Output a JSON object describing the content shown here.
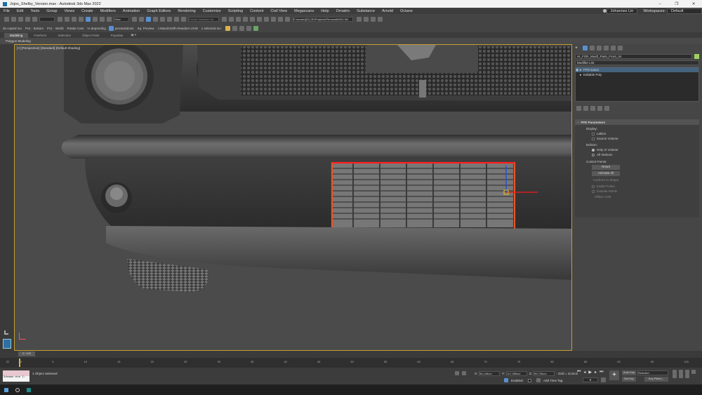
{
  "title": "Jojos_Shelby_Version.max - Autodesk 3ds Max 2022",
  "window_controls": [
    "–",
    "❐",
    "✕"
  ],
  "menu": [
    "File",
    "Edit",
    "Tools",
    "Group",
    "Views",
    "Create",
    "Modifiers",
    "Animation",
    "Graph Editors",
    "Rendering",
    "Customize",
    "Scripting",
    "Content",
    "Civil View",
    "Megascans",
    "Help",
    "Ornatrix",
    "Substance",
    "Arnold",
    "Octane"
  ],
  "user": "Johannes Lin",
  "workspaces_label": "Workspaces:",
  "workspace_value": "Default",
  "view_dropdown": "View",
  "create_selection_set": "Create Selection Se",
  "project_path": "E:\\nudes\\[02] 3D\\Projects\\Personal\\MX4 M4",
  "toolbar2_items": [
    "do copied mo",
    "Pv1 · Bottom",
    "Pv1 · World",
    "Rotate Cam",
    "% depending",
    "perasolutions",
    "Sq. Preview",
    "c:Max2019/fn-Random UVW",
    "o selected mo"
  ],
  "ribbon_tabs": [
    "Modeling",
    "Freeform",
    "Selection",
    "Object Paint",
    "Populate"
  ],
  "ribbon_sub": "Polygon Modeling",
  "viewport_label": "[+] [Perspective] [Standard] [Default Shading]",
  "object_name": "HI_FOR_Mustf_Paint_Front_04",
  "modifier_list": "Modifier List",
  "stack": [
    "FFD 2x2x2",
    "Editable Poly"
  ],
  "rollout_title": "FFD Parameters",
  "display_label": "Display:",
  "lattice": "Lattice",
  "source_volume": "Source Volume",
  "deform_label": "Deform:",
  "only_in_volume": "Only In Volume",
  "all_vertices": "All Vertices",
  "control_points_label": "Control Points:",
  "reset_btn": "Reset",
  "animate_all_btn": "Animate All",
  "conform_shape": "Conform to Shape",
  "inside_points": "Inside Points",
  "outside_points": "Outside Points",
  "offset": "Offset: 0,05",
  "time_slider": "0 / 100",
  "ruler_ticks": [
    "0",
    "5",
    "10",
    "15",
    "20",
    "25",
    "30",
    "35",
    "40",
    "45",
    "50",
    "55",
    "60",
    "65",
    "70",
    "75",
    "80",
    "85",
    "90",
    "95",
    "100"
  ],
  "maxscript_text": "3dsmax.exe I:",
  "status_text": "1 Object Selected",
  "coord_x_label": "X:",
  "coord_x": "36,146cm",
  "coord_y_label": "Y:",
  "coord_y": "117,365cm",
  "coord_z_label": "Z:",
  "coord_z": "95,705cm",
  "grid": "Grid = 10,0cm",
  "enabled_label": "Enabled:",
  "add_time_tag": "Add Time Tag",
  "auto_key": "Auto Key",
  "selected_dropdown": "Selected",
  "set_key": "Set Key",
  "key_filters": "Key Filters...",
  "frame_value": "0",
  "colors": {
    "accent": "#5a8fcf",
    "lattice_red": "#ff2020",
    "frame_gold": "#c59f2f"
  }
}
